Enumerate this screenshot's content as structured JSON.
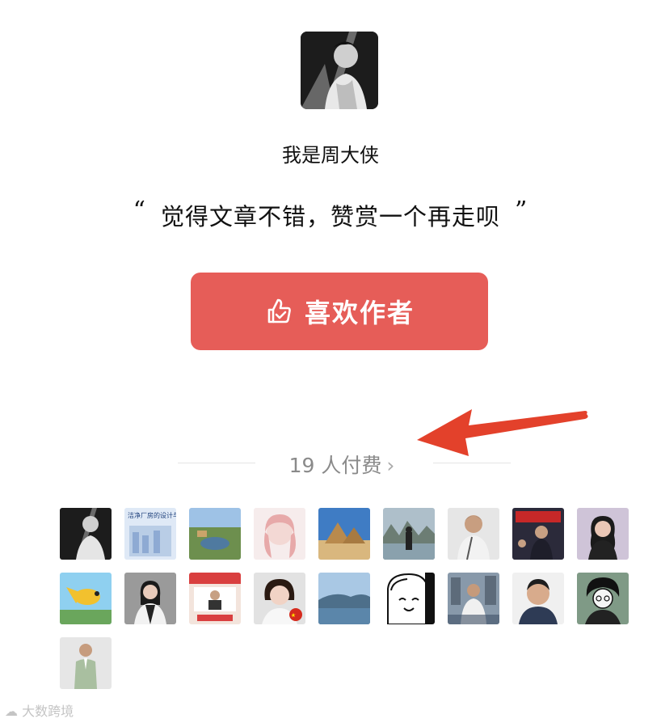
{
  "author": {
    "name": "我是周大侠"
  },
  "quote": {
    "open_mark": "“",
    "text": "觉得文章不错，赞赏一个再走呗",
    "close_mark": "”"
  },
  "like_button": {
    "label": "喜欢作者",
    "icon": "thumb-up-icon"
  },
  "payers": {
    "count_text": "19 人付费",
    "chevron": "›"
  },
  "supporters": [
    {
      "name": "supporter-avatar-1"
    },
    {
      "name": "supporter-avatar-2",
      "text": "洁净厂房的设计与施工"
    },
    {
      "name": "supporter-avatar-3"
    },
    {
      "name": "supporter-avatar-4"
    },
    {
      "name": "supporter-avatar-5"
    },
    {
      "name": "supporter-avatar-6"
    },
    {
      "name": "supporter-avatar-7"
    },
    {
      "name": "supporter-avatar-8"
    },
    {
      "name": "supporter-avatar-9"
    },
    {
      "name": "supporter-avatar-10"
    },
    {
      "name": "supporter-avatar-11"
    },
    {
      "name": "supporter-avatar-12"
    },
    {
      "name": "supporter-avatar-13"
    },
    {
      "name": "supporter-avatar-14"
    },
    {
      "name": "supporter-avatar-15"
    },
    {
      "name": "supporter-avatar-16"
    },
    {
      "name": "supporter-avatar-17"
    },
    {
      "name": "supporter-avatar-18"
    },
    {
      "name": "supporter-avatar-19"
    }
  ],
  "watermark": {
    "text": "大数跨境"
  },
  "colors": {
    "button": "#e65d58",
    "arrow": "#e3412b",
    "muted_text": "#8a8a8a"
  }
}
